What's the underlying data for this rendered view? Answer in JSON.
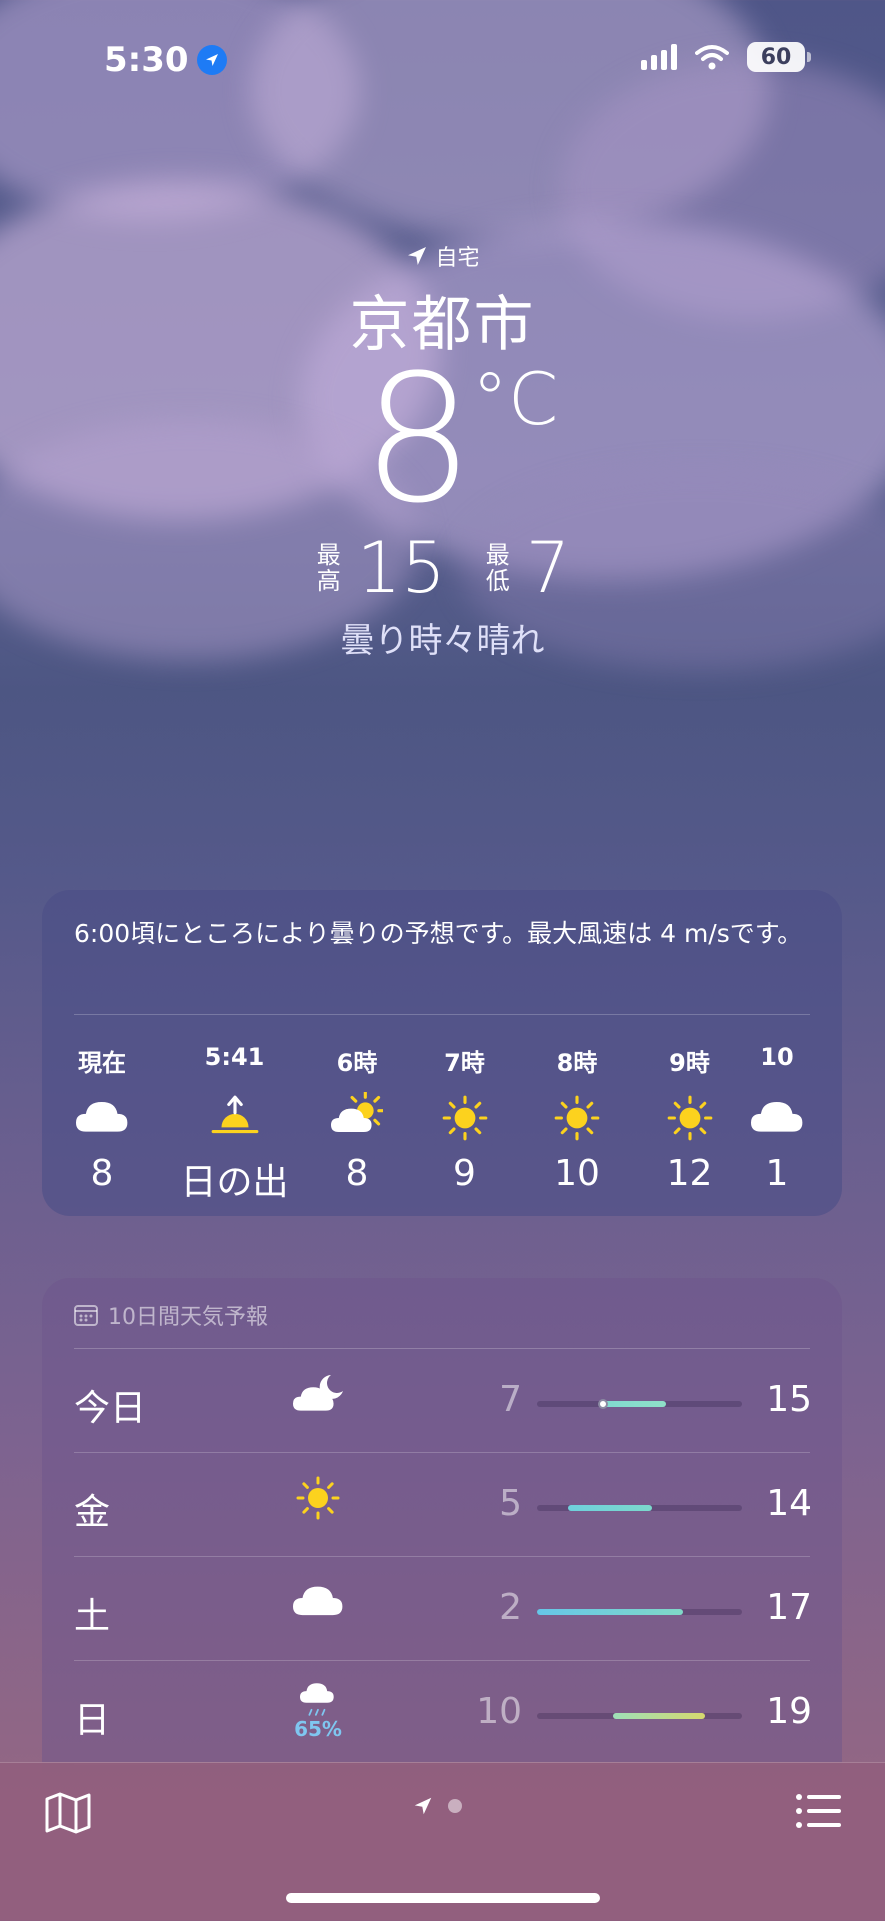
{
  "status_bar": {
    "time": "5:30",
    "battery": "60"
  },
  "location": {
    "home_label": "自宅",
    "city": "京都市"
  },
  "current": {
    "temp": "8",
    "unit": "°C",
    "high_label": "最高",
    "high": "15",
    "low_label": "最低",
    "low": "7",
    "condition": "曇り時々晴れ"
  },
  "summary": "6:00頃にところにより曇りの予想です。最大風速は 4 m/sです。",
  "hourly": [
    {
      "label": "現在",
      "icon": "cloud-icon",
      "value": "8"
    },
    {
      "label": "5:41",
      "icon": "sunrise-icon",
      "value": "日の出"
    },
    {
      "label": "6時",
      "icon": "partly-sunny-icon",
      "value": "8"
    },
    {
      "label": "7時",
      "icon": "sun-icon",
      "value": "9"
    },
    {
      "label": "8時",
      "icon": "sun-icon",
      "value": "10"
    },
    {
      "label": "9時",
      "icon": "sun-icon",
      "value": "12"
    },
    {
      "label": "10",
      "icon": "cloud-icon",
      "value": "1"
    }
  ],
  "forecast": {
    "title": "10日間天気予報",
    "days": [
      {
        "name": "今日",
        "icon": "partly-cloudy-moon-icon",
        "low": "7",
        "high": "15",
        "bar_start": 0.3,
        "bar_end": 0.63,
        "current_marker": 0.32,
        "colors": [
          "#7fd9d0",
          "#8fe0c8"
        ],
        "pop": ""
      },
      {
        "name": "金",
        "icon": "sun-icon",
        "low": "5",
        "high": "14",
        "bar_start": 0.15,
        "bar_end": 0.56,
        "colors": [
          "#6fd0dc",
          "#7cd8cc"
        ],
        "pop": ""
      },
      {
        "name": "土",
        "icon": "cloud-icon",
        "low": "2",
        "high": "17",
        "bar_start": 0.0,
        "bar_end": 0.71,
        "colors": [
          "#66c6e8",
          "#80d8c8"
        ],
        "pop": ""
      },
      {
        "name": "日",
        "icon": "rain-icon",
        "low": "10",
        "high": "19",
        "bar_start": 0.37,
        "bar_end": 0.82,
        "colors": [
          "#9ee0b8",
          "#d6d86e"
        ],
        "pop": "65%"
      }
    ]
  }
}
